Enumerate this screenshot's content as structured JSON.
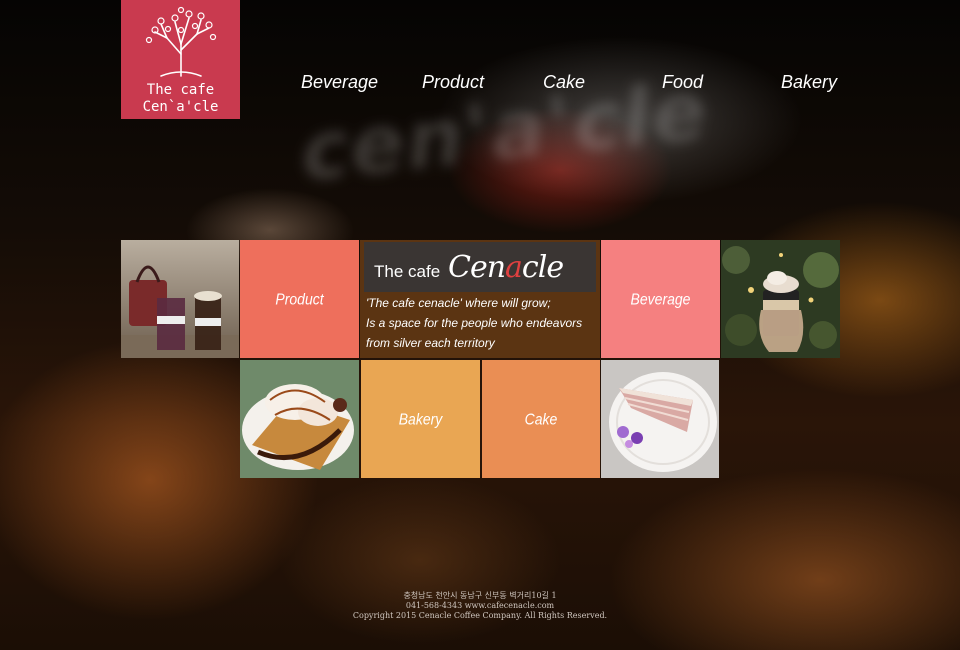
{
  "logo": {
    "line1": "The cafe",
    "line2": "Cen`a'cle",
    "color": "#c93a4f"
  },
  "nav": {
    "items": [
      {
        "label": "Beverage"
      },
      {
        "label": "Product"
      },
      {
        "label": "Cake"
      },
      {
        "label": "Food"
      },
      {
        "label": "Bakery"
      }
    ]
  },
  "background": {
    "sign_text": "cen'a'cle"
  },
  "tiles": {
    "product": {
      "label": "Product",
      "color": "#ee6f5c"
    },
    "beverage": {
      "label": "Beverage",
      "color": "#f58080"
    },
    "bakery": {
      "label": "Bakery",
      "color": "#e9a653"
    },
    "cake": {
      "label": "Cake",
      "color": "#ea8e54"
    },
    "banner": {
      "title": "The cafe",
      "brand_pre": "Cen",
      "brand_accent": "a",
      "brand_post": "cle",
      "tagline": [
        "'The cafe cenacle' where will grow;",
        "Is a space for the people who endeavors",
        "from silver each territory"
      ]
    }
  },
  "footer": {
    "address": "충청남도 천안시 동남구 신부동 벽거리10길 1",
    "contact": "041-568-4343  www.cafecenacle.com",
    "copyright": "Copyright 2015 Cenacle Coffee Company. All Rights Reserved."
  }
}
